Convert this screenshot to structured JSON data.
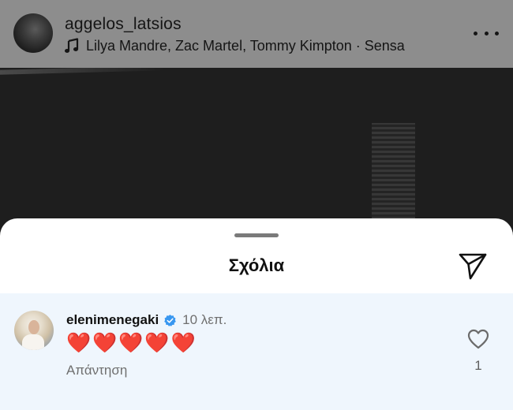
{
  "post": {
    "username": "aggelos_latsios",
    "audio": "Lilya Mandre, Zac Martel, Tommy Kimpton · Sensa",
    "icons": {
      "music": "music-note-icon",
      "more": "more-options-icon"
    }
  },
  "comments_sheet": {
    "title": "Σχόλια",
    "share_icon": "send-icon",
    "comments": [
      {
        "username": "elenimenegaki",
        "verified": true,
        "time": "10 λεπ.",
        "text": "❤️❤️❤️❤️❤️",
        "reply_label": "Απάντηση",
        "like_count": "1",
        "like_icon": "heart-outline-icon"
      }
    ]
  },
  "colors": {
    "accent_verified": "#3897f0",
    "highlight_row": "#eff6fd",
    "overlay_header": "#8d8d8d"
  }
}
